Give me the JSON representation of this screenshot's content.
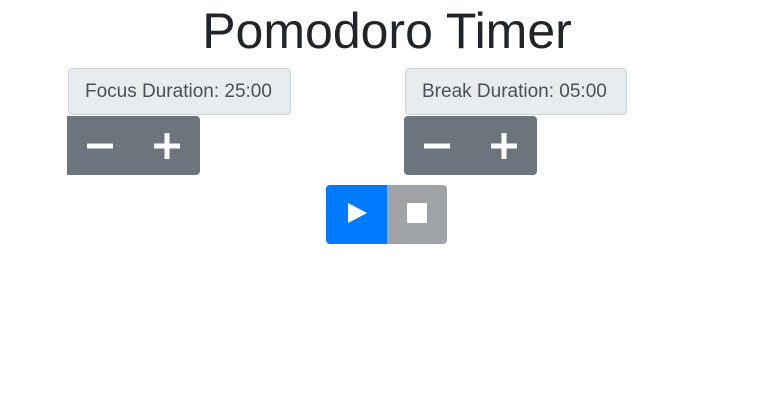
{
  "header": {
    "title": "Pomodoro Timer"
  },
  "focus": {
    "label": "Focus Duration: 25:00",
    "decrease_icon": "minus-icon",
    "increase_icon": "plus-icon"
  },
  "break": {
    "label": "Break Duration: 05:00",
    "decrease_icon": "minus-icon",
    "increase_icon": "plus-icon"
  },
  "controls": {
    "play_icon": "play-icon",
    "stop_icon": "stop-icon"
  },
  "colors": {
    "primary": "#007bff",
    "secondary": "#6c757d",
    "stop_button": "#9fa3a8",
    "label_background": "#e9ecef",
    "title_text": "#212529"
  }
}
